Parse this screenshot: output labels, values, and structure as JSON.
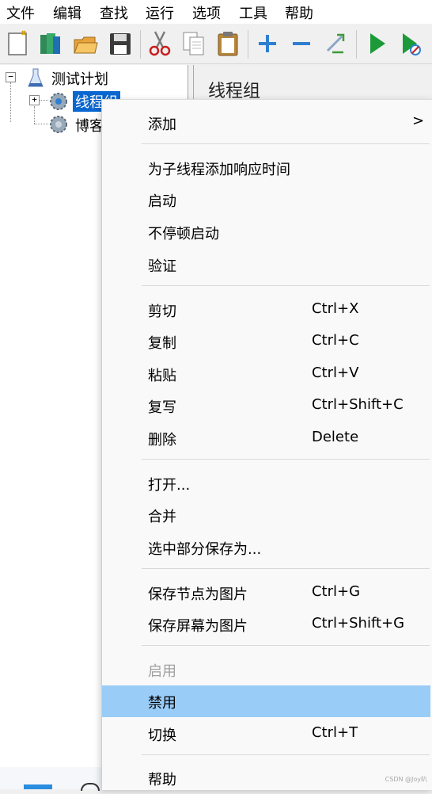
{
  "menubar": [
    "文件",
    "编辑",
    "查找",
    "运行",
    "选项",
    "工具",
    "帮助"
  ],
  "toolbar": {
    "icons": [
      "new-icon",
      "templates-icon",
      "open-icon",
      "save-icon",
      "cut-icon",
      "copy-icon",
      "paste-icon",
      "expand-icon",
      "collapse-icon",
      "toggle-icon",
      "start-icon",
      "start-no-pauses-icon"
    ]
  },
  "tree": {
    "root": "测试计划",
    "children": [
      "线程组",
      "博客"
    ]
  },
  "panel": {
    "title": "线程组"
  },
  "context_menu": {
    "items": [
      {
        "label": "添加",
        "submenu": true
      },
      {
        "label": "为子线程添加响应时间"
      },
      {
        "label": "启动"
      },
      {
        "label": "不停顿启动"
      },
      {
        "label": "验证"
      },
      {
        "label": "剪切",
        "shortcut": "Ctrl+X"
      },
      {
        "label": "复制",
        "shortcut": "Ctrl+C"
      },
      {
        "label": "粘贴",
        "shortcut": "Ctrl+V"
      },
      {
        "label": "复写",
        "shortcut": "Ctrl+Shift+C"
      },
      {
        "label": "删除",
        "shortcut": "Delete"
      },
      {
        "label": "打开..."
      },
      {
        "label": "合并"
      },
      {
        "label": "选中部分保存为..."
      },
      {
        "label": "保存节点为图片",
        "shortcut": "Ctrl+G"
      },
      {
        "label": "保存屏幕为图片",
        "shortcut": "Ctrl+Shift+G"
      },
      {
        "label": "启用",
        "disabled": true
      },
      {
        "label": "禁用",
        "highlighted": true
      },
      {
        "label": "切换",
        "shortcut": "Ctrl+T"
      },
      {
        "label": "帮助"
      }
    ],
    "submenu_arrow": ">"
  },
  "watermark": "CSDN @Joy叭",
  "colors": {
    "selection": "#0a67d0",
    "menu_highlight": "#99ccf7",
    "disabled_text": "#a0a0a0"
  }
}
